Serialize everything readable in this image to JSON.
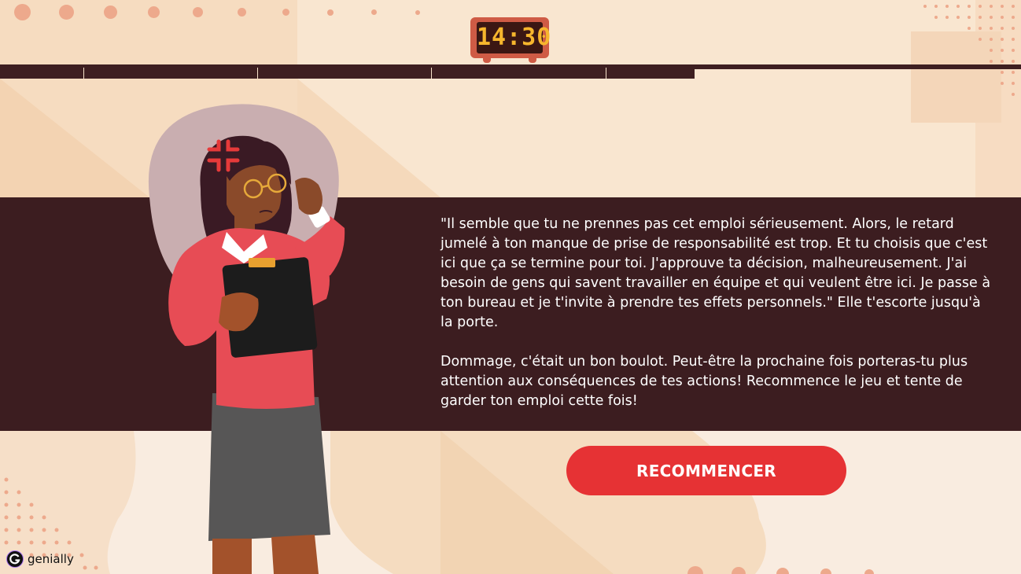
{
  "clock": {
    "time": "14:30"
  },
  "progress": {
    "segments_total": 12,
    "segments_completed": 5,
    "fraction": 0.68
  },
  "dialog": {
    "paragraph_1": "\"Il semble que tu ne prennes pas cet emploi sérieusement. Alors, le retard jumelé à ton manque de prise de responsabilité est trop. Et tu choisis que c'est ici que ça se termine pour toi. J'approuve ta décision, malheureusement. J'ai besoin de gens qui savent travailler en équipe et qui veulent être ici. Je passe à ton bureau et je t'invite à prendre tes effets personnels.\"  Elle t'escorte jusqu'à la porte.",
    "paragraph_2": "Dommage, c'était un bon boulot. Peut-être la prochaine fois porteras-tu plus attention aux conséquences de tes actions! Recommence le jeu et tente de garder ton emploi cette fois!"
  },
  "restart_button": {
    "label": "RECOMMENCER"
  },
  "branding": {
    "logo_text": "genially"
  },
  "colors": {
    "background": "#f8e3cb",
    "dialog_band": "#3c1d20",
    "button": "#e63234",
    "clock_digits": "#f6b62d",
    "accent_dots": "#eda98c"
  },
  "icons": {
    "anger_symbol": "anger-icon",
    "logo_mark": "genially-logo-icon"
  }
}
